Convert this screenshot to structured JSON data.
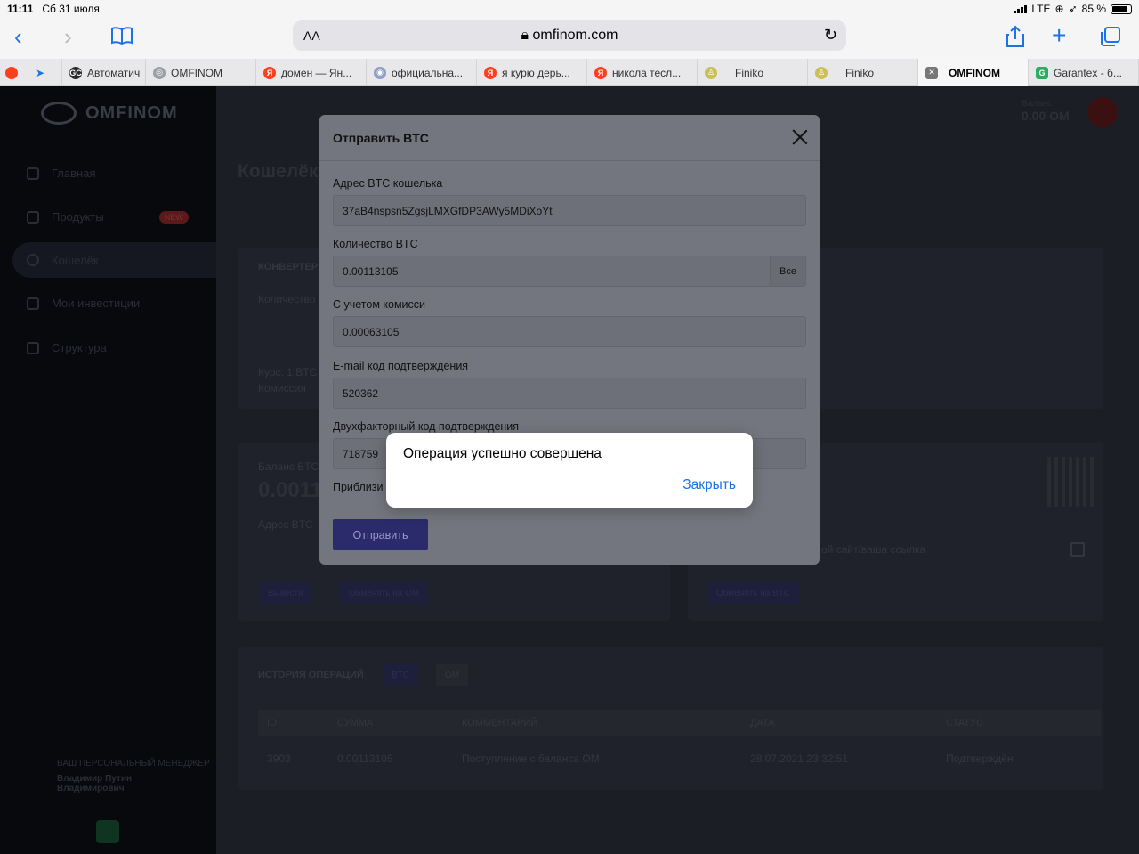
{
  "statusbar": {
    "time": "11:11",
    "date": "Сб 31 июля",
    "network": "LTE",
    "battery": "85 %",
    "battery_level": 0.85
  },
  "browser": {
    "aa": "AA",
    "url": "omfinom.com",
    "icons": [
      "back-icon",
      "forward-icon",
      "bookmarks-icon",
      "lock-icon",
      "reload-icon",
      "share-icon",
      "new-tab-icon",
      "tabs-icon"
    ]
  },
  "tabs": [
    {
      "label": "Автоматич",
      "fav": "GC",
      "color": "#2b2b2b"
    },
    {
      "label": "OMFINOM",
      "fav": "◎",
      "color": "#9aa0a6"
    },
    {
      "label": "домен — Ян...",
      "fav": "Я",
      "color": "#fc3f1d"
    },
    {
      "label": "официальна...",
      "fav": "◉",
      "color": "#8fa0c4"
    },
    {
      "label": "я курю дерь...",
      "fav": "Я",
      "color": "#fc3f1d"
    },
    {
      "label": "никола тесл...",
      "fav": "Я",
      "color": "#fc3f1d"
    },
    {
      "label": "Finiko",
      "fav": "♙",
      "color": "#cbbf5a"
    },
    {
      "label": "Finiko",
      "fav": "♙",
      "color": "#cbbf5a"
    },
    {
      "label": "OMFINOM",
      "fav": "✕",
      "color": "#777777",
      "active": true
    },
    {
      "label": "Garantex - б...",
      "fav": "G",
      "color": "#27ae60"
    }
  ],
  "site": {
    "logo": "OMFINOM",
    "nav": [
      {
        "label": "Главная"
      },
      {
        "label": "Продукты",
        "badge": "NEW"
      },
      {
        "label": "Кошелёк",
        "active": true
      },
      {
        "label": "Мои инвестиции"
      },
      {
        "label": "Структура"
      }
    ],
    "user": {
      "role": "ВАШ ПЕРСОНАЛЬНЫЙ МЕНЕДЖЕР",
      "name1": "Владимир Путин",
      "name2": "Владимирович"
    },
    "page_title": "Кошелёк",
    "balance_label": "Баланс",
    "balance_value": "0.00 OM",
    "converter_title": "КОНВЕРТЕР",
    "converter_amount": "Количество",
    "rate": "Курс: 1 BTC",
    "commission": "Комиссия",
    "btc_balance_label": "Баланс BTC",
    "btc_balance": "0.0011",
    "btc_address_label": "Адрес BTC",
    "withdraw": "Вывести",
    "exchange_om": "Обменять на OM",
    "exchange_btc": "Обменять на BTC",
    "copy_hint": "ой сайт/ваша ссылка",
    "history_title": "ИСТОРИЯ ОПЕРАЦИЙ",
    "history_tabs": [
      "BTC",
      "OM"
    ],
    "table_headers": [
      "ID",
      "СУММА",
      "КОММЕНТАРИЙ",
      "ДАТА",
      "СТАТУС"
    ],
    "table_rows": [
      [
        "3903",
        "0.00113105",
        "Поступление с баланса OM",
        "28.07.2021 23:32:51",
        "Подтверждён"
      ]
    ]
  },
  "modal": {
    "title": "Отправить BTC",
    "address_label": "Адрес BTC кошелька",
    "address_value": "37aB4nspsn5ZgsjLMXGfDP3AWy5MDiXoYt",
    "amount_label": "Количество BTC",
    "amount_value": "0.00113105",
    "all_label": "Все",
    "fee_label": "С учетом комисси",
    "fee_value": "0.00063105",
    "email_code_label": "E-mail код подтверждения",
    "email_code_value": "520362",
    "twofa_label": "Двухфакторный код подтверждения",
    "twofa_value": "718759",
    "approx_label": "Приблизи",
    "send_label": "Отправить"
  },
  "alert": {
    "message": "Операция успешно совершена",
    "close_label": "Закрыть"
  }
}
